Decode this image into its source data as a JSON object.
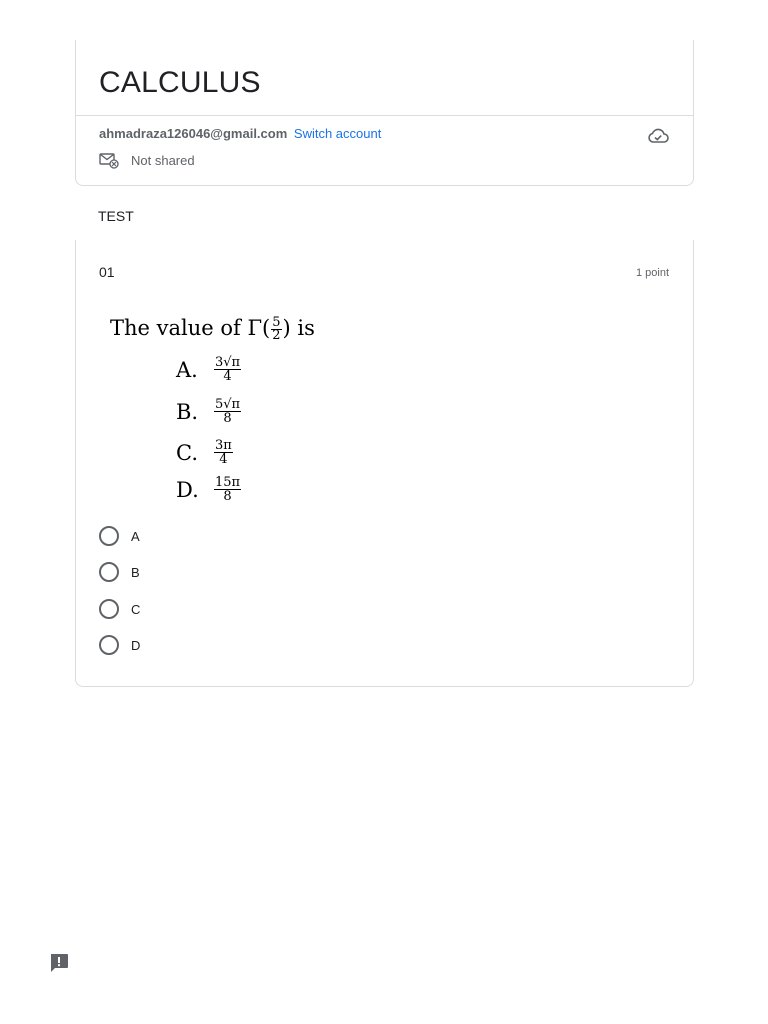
{
  "form": {
    "title": "CALCULUS",
    "account_email": "ahmadraza126046@gmail.com",
    "switch_account_label": "Switch account",
    "share_status": "Not shared",
    "cloud_icon": "cloud-saved-icon"
  },
  "section": {
    "title": "TEST"
  },
  "question": {
    "number": "01",
    "points": "1 point",
    "image_text": {
      "stem_prefix": "The value of Γ(",
      "stem_frac_num": "5",
      "stem_frac_den": "2",
      "stem_suffix": ") is",
      "options": [
        {
          "letter": "A.",
          "num": "3√π",
          "den": "4"
        },
        {
          "letter": "B.",
          "num": "5√π",
          "den": "8"
        },
        {
          "letter": "C.",
          "num": "3π",
          "den": "4"
        },
        {
          "letter": "D.",
          "num": "15π",
          "den": "8"
        }
      ]
    },
    "choices": [
      {
        "label": "A"
      },
      {
        "label": "B"
      },
      {
        "label": "C"
      },
      {
        "label": "D"
      }
    ]
  },
  "feedback_icon": "report-problem-icon"
}
